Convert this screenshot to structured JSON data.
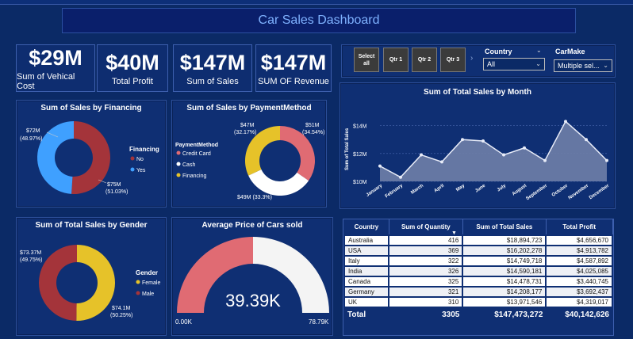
{
  "dashboard_title": "Car Sales Dashboard",
  "kpis": [
    {
      "value": "$29M",
      "label": "Sum of Vehical Cost"
    },
    {
      "value": "$40M",
      "label": "Total Profit"
    },
    {
      "value": "$147M",
      "label": "Sum of Sales"
    },
    {
      "value": "$147M",
      "label": "SUM OF Revenue"
    }
  ],
  "filters": {
    "buttons": [
      "Select all",
      "Qtr 1",
      "Qtr 2",
      "Qtr 3"
    ],
    "country_label": "Country",
    "country_value": "All",
    "carmake_label": "CarMake",
    "carmake_value": "Multiple sel..."
  },
  "financing_chart": {
    "title": "Sum of Sales by Financing",
    "legend_title": "Financing",
    "legend": [
      "No",
      "Yes"
    ],
    "label_no": "$75M",
    "label_no_pct": "(51.03%)",
    "label_yes": "$72M",
    "label_yes_pct": "(48.97%)"
  },
  "payment_chart": {
    "title": "Sum of Sales by PaymentMethod",
    "legend_title": "PaymentMethod",
    "legend": [
      "Credit Card",
      "Cash",
      "Financing"
    ],
    "label_a": "$47M",
    "label_a_pct": "(32.17%)",
    "label_b": "$51M",
    "label_b_pct": "(34.54%)",
    "label_c": "$49M (33.3%)"
  },
  "gender_chart": {
    "title": "Sum of Total Sales by Gender",
    "legend_title": "Gender",
    "legend": [
      "Female",
      "Male"
    ],
    "label_a": "$73.37M",
    "label_a_pct": "(49.75%)",
    "label_b": "$74.1M",
    "label_b_pct": "(50.25%)"
  },
  "gauge": {
    "title": "Average Price of Cars sold",
    "value_label": "39.39K",
    "min_label": "0.00K",
    "max_label": "78.79K"
  },
  "chart_data": [
    {
      "type": "pie",
      "title": "Sum of Sales by Financing",
      "categories": [
        "No",
        "Yes"
      ],
      "values": [
        75,
        72
      ],
      "colors": [
        "#a4343a",
        "#3fa0ff"
      ]
    },
    {
      "type": "pie",
      "title": "Sum of Sales by PaymentMethod",
      "categories": [
        "Credit Card",
        "Cash",
        "Financing"
      ],
      "values": [
        51,
        49,
        47
      ],
      "colors": [
        "#e06b73",
        "#ffffff",
        "#e6c229"
      ]
    },
    {
      "type": "pie",
      "title": "Sum of Total Sales by Gender",
      "categories": [
        "Female",
        "Male"
      ],
      "values": [
        74.1,
        73.37
      ],
      "colors": [
        "#e6c229",
        "#a4343a"
      ]
    },
    {
      "type": "area",
      "title": "Sum of Total Sales by Month",
      "ylabel": "Sum of Total Sales",
      "categories": [
        "January",
        "February",
        "March",
        "April",
        "May",
        "June",
        "July",
        "August",
        "September",
        "October",
        "November",
        "December"
      ],
      "values": [
        11.1,
        10.3,
        11.9,
        11.4,
        13.0,
        12.9,
        11.9,
        12.4,
        11.5,
        14.3,
        13.0,
        11.5
      ],
      "ylim": [
        10,
        15
      ],
      "yticks": [
        "$10M",
        "$12M",
        "$14M"
      ]
    }
  ],
  "table": {
    "headers": [
      "Country",
      "Sum of Quantity",
      "Sum of Total Sales",
      "Total Profit"
    ],
    "rows": [
      [
        "Australia",
        "416",
        "$18,894,723",
        "$4,656,670"
      ],
      [
        "USA",
        "369",
        "$16,202,278",
        "$4,913,782"
      ],
      [
        "Italy",
        "322",
        "$14,749,718",
        "$4,587,892"
      ],
      [
        "India",
        "326",
        "$14,590,181",
        "$4,025,085"
      ],
      [
        "Canada",
        "325",
        "$14,478,731",
        "$3,440,745"
      ],
      [
        "Germany",
        "321",
        "$14,208,177",
        "$3,692,437"
      ],
      [
        "UK",
        "310",
        "$13,971,546",
        "$4,319,017"
      ]
    ],
    "total": [
      "Total",
      "3305",
      "$147,473,272",
      "$40,142,626"
    ]
  }
}
